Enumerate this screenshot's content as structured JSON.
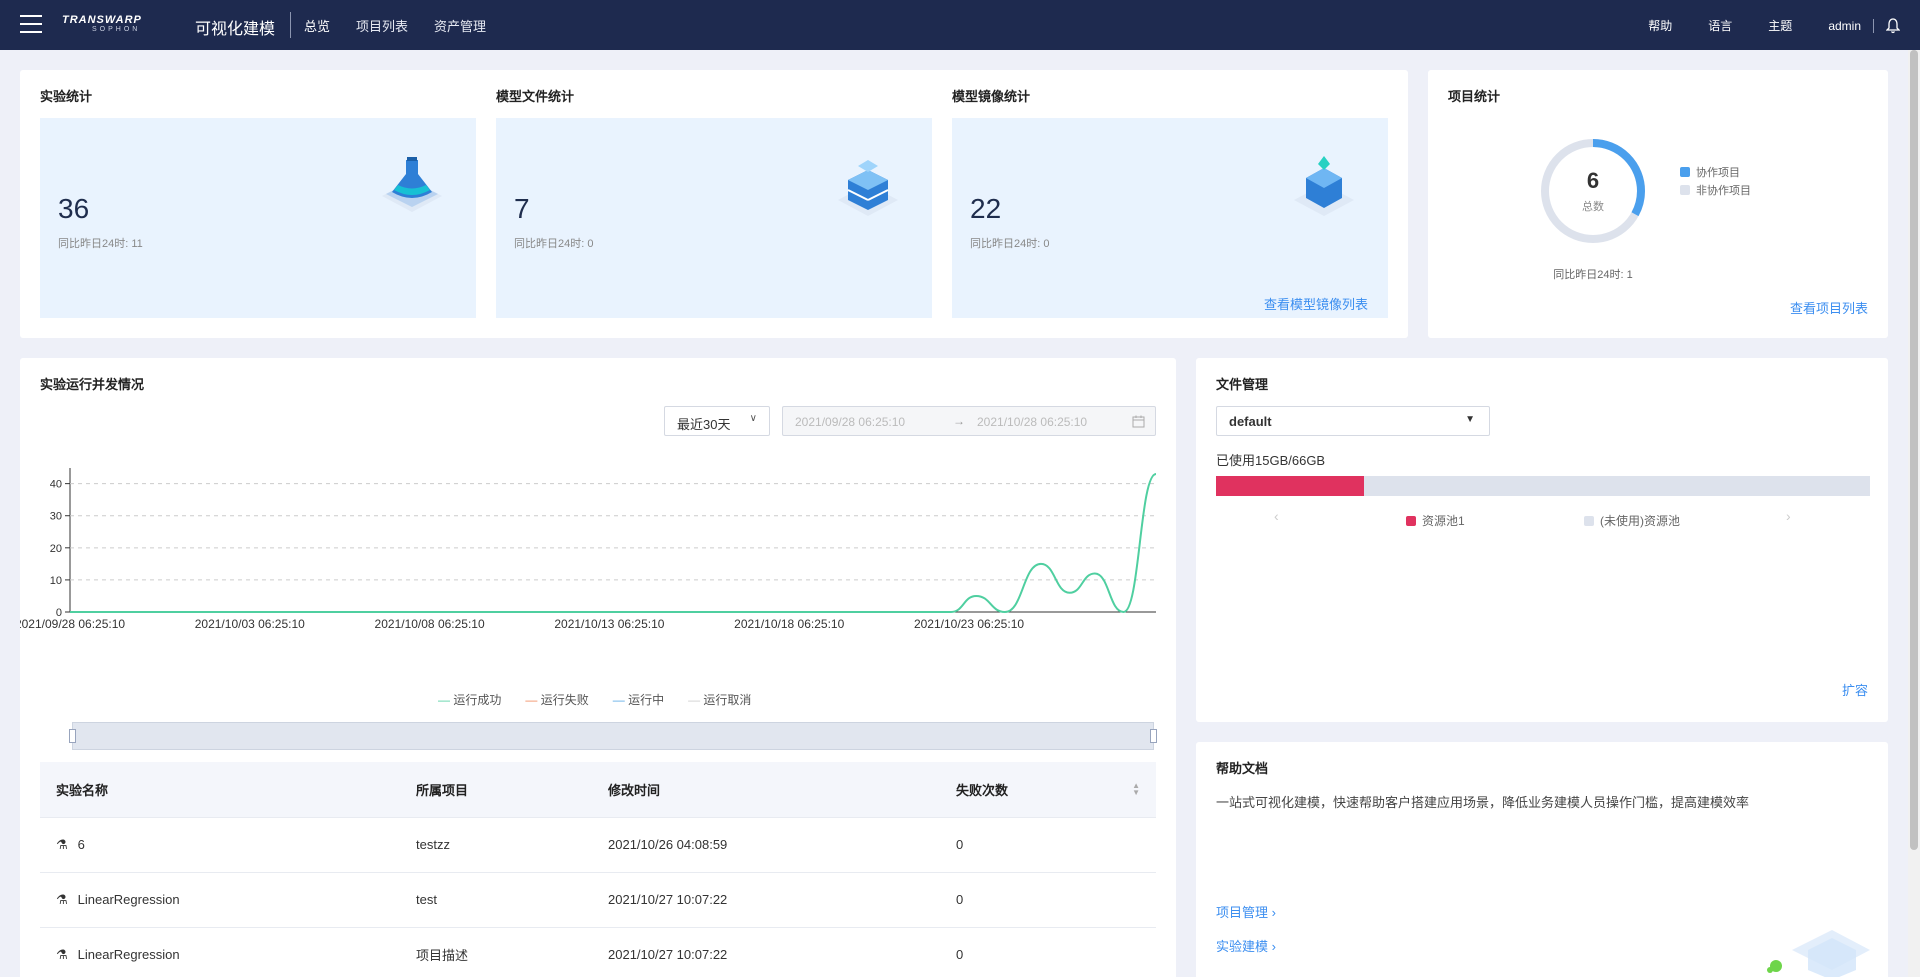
{
  "nav": {
    "logo_top": "TRANSWARP",
    "logo_bottom": "SOPHON",
    "app_title": "可视化建模",
    "links": [
      "总览",
      "项目列表",
      "资产管理"
    ],
    "right": {
      "help": "帮助",
      "language": "语言",
      "theme": "主题",
      "user": "admin"
    }
  },
  "stats": {
    "experiment": {
      "title": "实验统计",
      "value": "36",
      "sub": "同比昨日24时: 11"
    },
    "model_file": {
      "title": "模型文件统计",
      "value": "7",
      "sub": "同比昨日24时: 0"
    },
    "model_image": {
      "title": "模型镜像统计",
      "value": "22",
      "sub": "同比昨日24时: 0",
      "link": "查看模型镜像列表"
    }
  },
  "project_stats": {
    "title": "项目统计",
    "total": "6",
    "total_label": "总数",
    "collab_fraction": 0.33,
    "legend": [
      "协作项目",
      "非协作项目"
    ],
    "sub": "同比昨日24时: 1",
    "link": "查看项目列表"
  },
  "concurrency": {
    "title": "实验运行并发情况",
    "range_select": "最近30天",
    "date_start": "2021/09/28 06:25:10",
    "date_arrow": "→",
    "date_end": "2021/10/28 06:25:10"
  },
  "chart_data": {
    "type": "line",
    "x": [
      "2021/09/28 06:25:10",
      "2021/10/03 06:25:10",
      "2021/10/08 06:25:10",
      "2021/10/13 06:25:10",
      "2021/10/18 06:25:10",
      "2021/10/23 06:25:10"
    ],
    "y_ticks": [
      0,
      10,
      20,
      30,
      40
    ],
    "ylim": [
      0,
      43
    ],
    "grid": true,
    "legend_position": "bottom",
    "series": [
      {
        "name": "运行成功",
        "color": "#4fcfa0",
        "points": [
          [
            0,
            0
          ],
          [
            24.5,
            0
          ],
          [
            25.2,
            5
          ],
          [
            26,
            0
          ],
          [
            27,
            15
          ],
          [
            27.8,
            6
          ],
          [
            28.5,
            12
          ],
          [
            29.3,
            0
          ],
          [
            30.2,
            43
          ]
        ]
      },
      {
        "name": "运行失败",
        "color": "#f08a5d",
        "points": []
      },
      {
        "name": "运行中",
        "color": "#5aa9e6",
        "points": []
      },
      {
        "name": "运行取消",
        "color": "#cccccc",
        "points": []
      }
    ],
    "x_days_total": 30.2
  },
  "table": {
    "headers": [
      "实验名称",
      "所属项目",
      "修改时间",
      "失败次数"
    ],
    "rows": [
      {
        "name": "6",
        "project": "testzz",
        "time": "2021/10/26 04:08:59",
        "fails": "0"
      },
      {
        "name": "LinearRegression",
        "project": "test",
        "time": "2021/10/27 10:07:22",
        "fails": "0"
      },
      {
        "name": "LinearRegression",
        "project": "项目描述",
        "time": "2021/10/27 10:07:22",
        "fails": "0"
      }
    ]
  },
  "file_mgmt": {
    "title": "文件管理",
    "select": "default",
    "usage": "已使用15GB/66GB",
    "used_fraction": 0.227,
    "legend": [
      "资源池1",
      "(未使用)资源池"
    ],
    "colors": {
      "used": "#e0325f",
      "unused": "#dde2ec"
    },
    "link": "扩容"
  },
  "help_docs": {
    "title": "帮助文档",
    "desc": "一站式可视化建模，快速帮助客户搭建应用场景，降低业务建模人员操作门槛，提高建模效率",
    "links": [
      "项目管理",
      "实验建模"
    ]
  }
}
